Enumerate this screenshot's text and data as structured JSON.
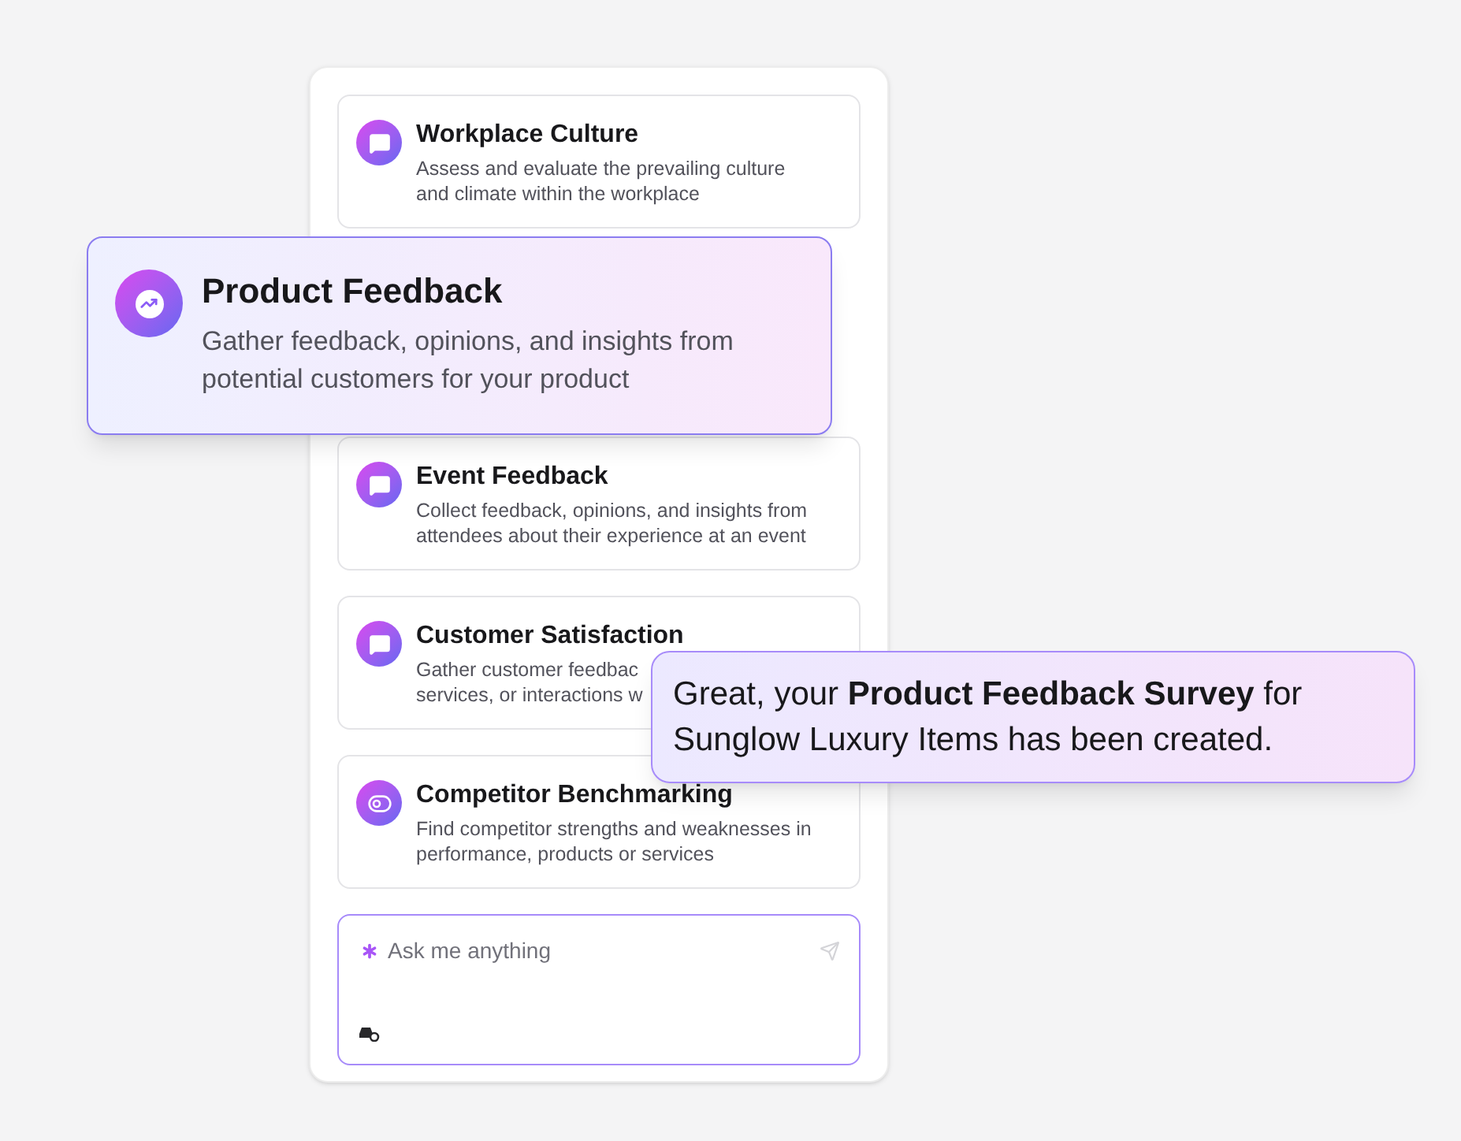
{
  "templates": [
    {
      "kind": "survey",
      "title": "Workplace Culture",
      "description_lines": [
        "Assess and evaluate the prevailing culture",
        "and climate within the workplace"
      ]
    },
    {
      "kind": "hidden"
    },
    {
      "kind": "survey",
      "title": "Event Feedback",
      "description_lines": [
        "Collect feedback, opinions, and insights from",
        "attendees about their experience at an event"
      ]
    },
    {
      "kind": "survey",
      "title": "Customer Satisfaction",
      "description_lines": [
        "Gather customer feedbac",
        "services, or interactions w"
      ]
    },
    {
      "kind": "comparison",
      "title": "Competitor Benchmarking",
      "description_lines": [
        "Find competitor strengths and weaknesses in",
        "performance, products or services"
      ]
    }
  ],
  "highlighted_template": {
    "title": "Product Feedback",
    "description_lines": [
      "Gather feedback, opinions, and insights from",
      "potential customers for your product"
    ]
  },
  "chat_input": {
    "placeholder": "Ask me anything"
  },
  "notification": {
    "message": "Great, your **Product Feedback Survey** for",
    "message_line_2": "Sunglow Luxury Items has been created."
  }
}
